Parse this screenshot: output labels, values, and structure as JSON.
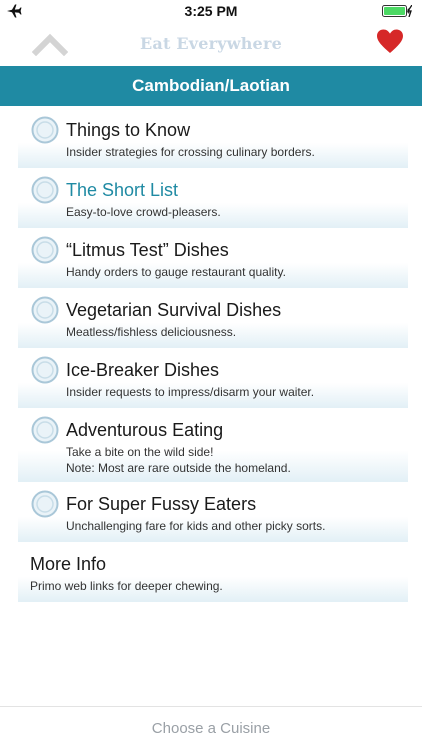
{
  "status_bar": {
    "time": "3:25 PM",
    "airplane_icon": "airplane-icon",
    "battery_icon": "battery-charging-icon"
  },
  "nav": {
    "title": "Eat Everywhere",
    "back_icon": "chevron-up-icon",
    "favorite_icon": "heart-icon",
    "colors": {
      "title": "#c9d7e4",
      "back": "#d4d4d4",
      "heart": "#d62828"
    }
  },
  "section": {
    "title": "Cambodian/Laotian",
    "color": "#1f8aa3"
  },
  "menu": {
    "items": [
      {
        "label": "Things to Know",
        "subtitle": "Insider strategies for crossing culinary borders.",
        "icon": "plate-icon"
      },
      {
        "label": "The Short List",
        "subtitle": "Easy-to-love crowd-pleasers.",
        "icon": "plate-icon",
        "selected": true
      },
      {
        "label": "“Litmus Test” Dishes",
        "subtitle": "Handy orders to gauge restaurant quality.",
        "icon": "plate-icon"
      },
      {
        "label": "Vegetarian Survival Dishes",
        "subtitle": "Meatless/fishless deliciousness.",
        "icon": "plate-icon"
      },
      {
        "label": "Ice-Breaker Dishes",
        "subtitle": "Insider requests to impress/disarm your waiter.",
        "icon": "plate-icon"
      },
      {
        "label": "Adventurous Eating",
        "subtitle_lines": [
          "Take a bite on the wild side!",
          "Note: Most are rare outside the homeland."
        ],
        "icon": "plate-icon"
      },
      {
        "label": "For Super Fussy Eaters",
        "subtitle": "Unchallenging fare for kids and other picky sorts.",
        "icon": "plate-icon"
      }
    ],
    "more_info": {
      "label": "More Info",
      "subtitle": "Primo web links for deeper chewing."
    }
  },
  "bottom_bar": {
    "label": "Choose a Cuisine"
  }
}
